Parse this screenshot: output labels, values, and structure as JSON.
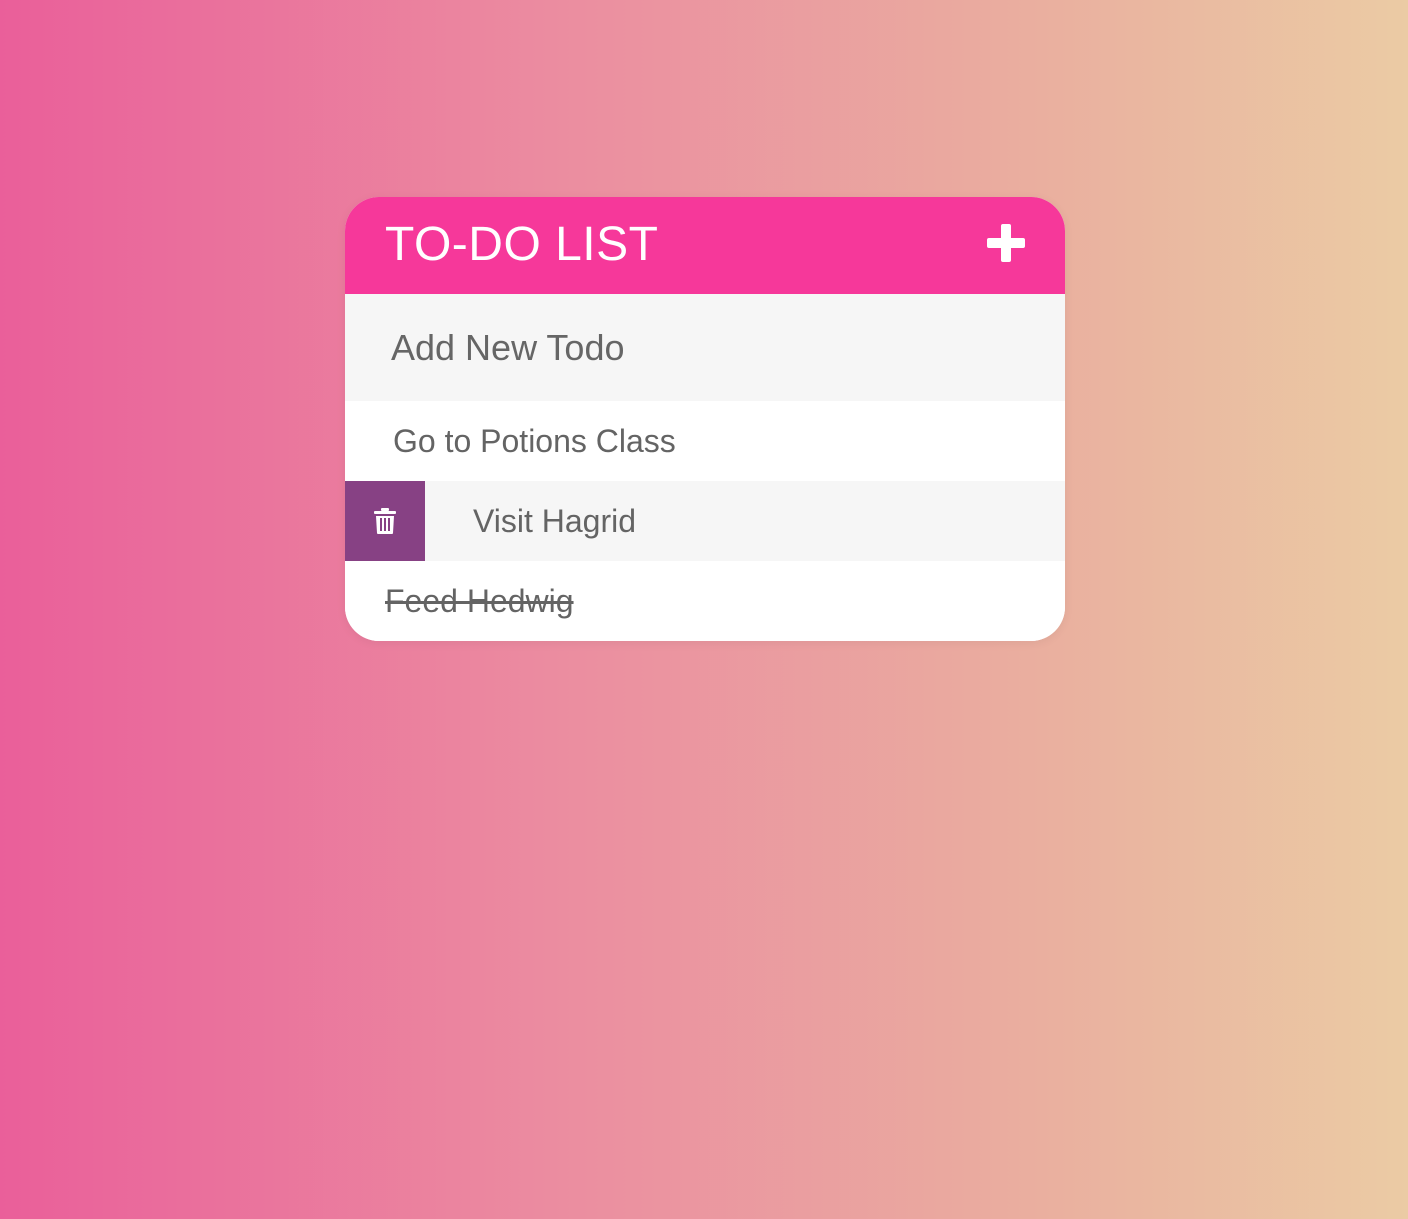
{
  "app": {
    "title": "TO-DO LIST",
    "add_icon": "plus-icon"
  },
  "new_todo": {
    "placeholder": "Add New Todo",
    "value": ""
  },
  "todos": [
    {
      "text": "Go to Potions Class",
      "completed": false
    },
    {
      "text": "Visit Hagrid",
      "completed": false,
      "hovered": true,
      "delete_icon": "trash-icon"
    },
    {
      "text": "Feed Hedwig",
      "completed": true
    }
  ],
  "colors": {
    "header": "#f6389a",
    "delete": "#874184",
    "text": "#646464",
    "row_alt": "#f6f6f6",
    "gradient_start": "#ea5f9a",
    "gradient_end": "#ebcba4"
  }
}
